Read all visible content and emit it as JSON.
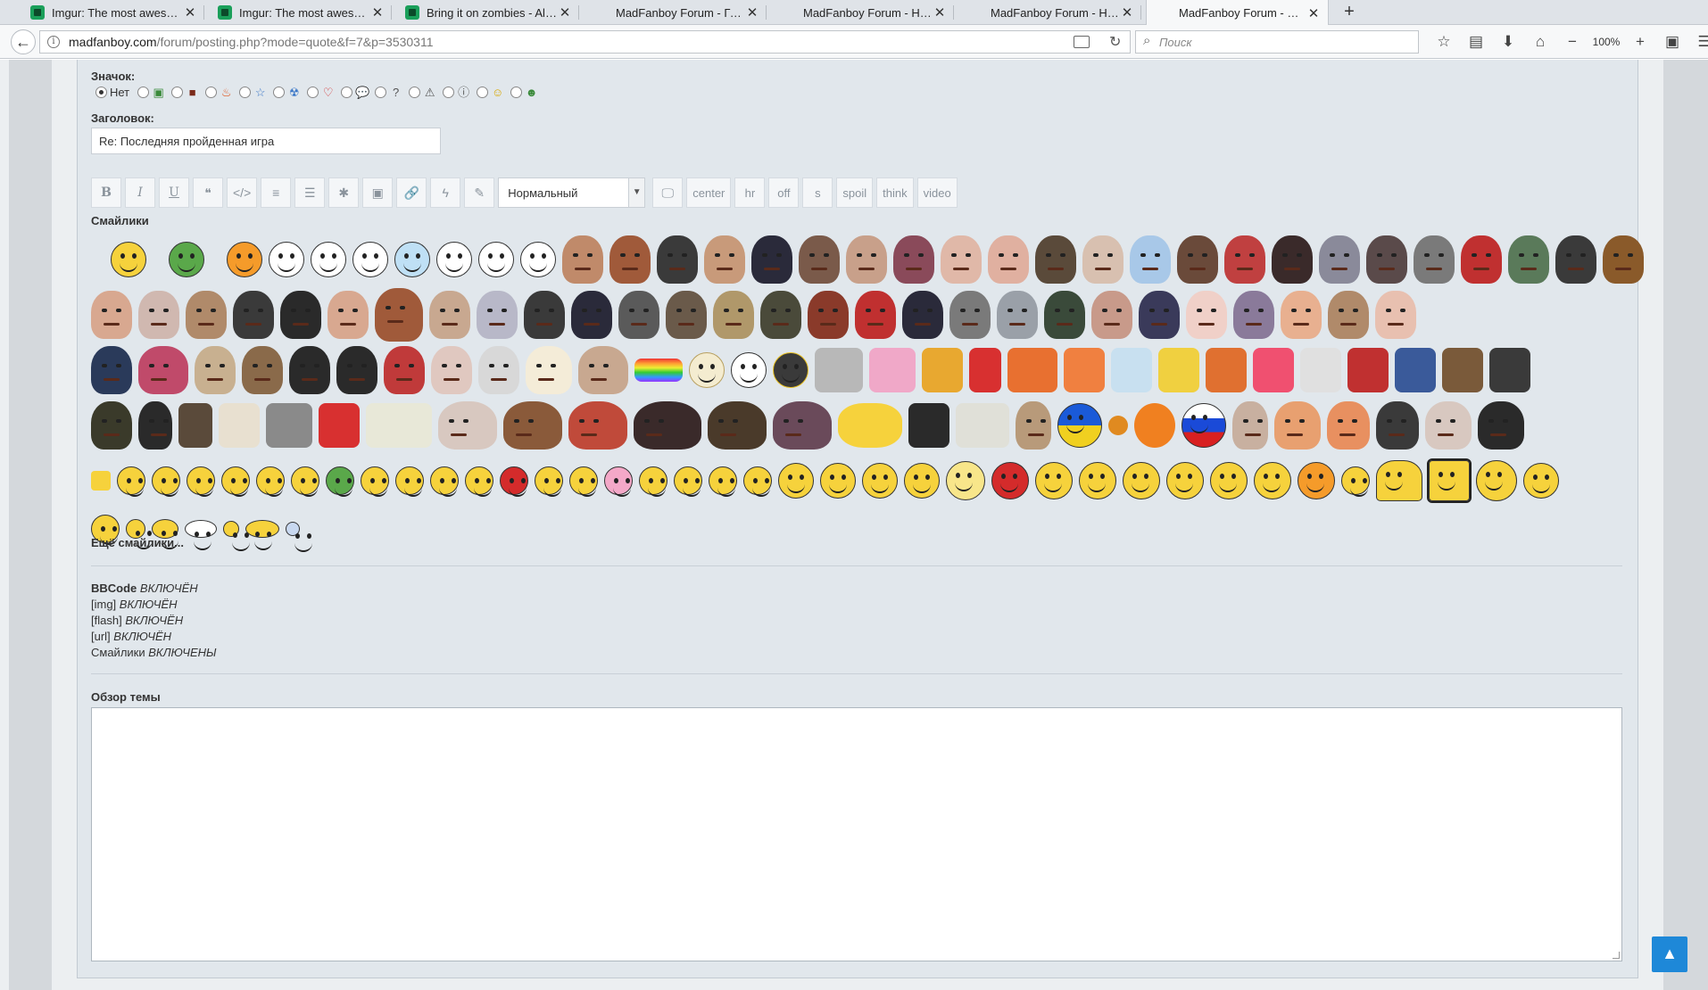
{
  "browser": {
    "tabs": [
      {
        "title": "Imgur: The most awesom...",
        "has_icon": true
      },
      {
        "title": "Imgur: The most awesom...",
        "has_icon": true
      },
      {
        "title": "Bring it on zombies - Albu...",
        "has_icon": true
      },
      {
        "title": "MadFanboy Forum - Глав...",
        "has_icon": false
      },
      {
        "title": "MadFanboy Forum - Нов...",
        "has_icon": false
      },
      {
        "title": "MadFanboy Forum - Нов...",
        "has_icon": false
      },
      {
        "title": "MadFanboy Forum - Отве...",
        "has_icon": false,
        "active": true
      }
    ],
    "new_tab": "+",
    "url_host": "madfanboy.com",
    "url_path": "/forum/posting.php?mode=quote&f=7&p=3530311",
    "search_placeholder": "Поиск",
    "zoom": "100%"
  },
  "form": {
    "icon_label": "Значок:",
    "icon_none": "Нет",
    "subject_label": "Заголовок:",
    "subject_value": "Re: Последняя пройденная игра",
    "font_size_value": "Нормальный",
    "toolbar_buttons": [
      "B",
      "I",
      "U",
      "❝",
      "</>",
      "≡",
      "☰",
      "✱",
      "▣",
      "🔗",
      "ϟ",
      "✎"
    ],
    "custom_buttons": [
      "center",
      "hr",
      "off",
      "s",
      "spoil",
      "think",
      "video"
    ],
    "smilies_label": "Смайлики",
    "more_smilies": "Ещё смайлики...",
    "bbcode_label": "BBCode",
    "bbcode_state": "ВКЛЮЧЁН",
    "img_label": "[img]",
    "img_state": "ВКЛЮЧЁН",
    "flash_label": "[flash]",
    "flash_state": "ВКЛЮЧЁН",
    "url_label": "[url]",
    "url_state": "ВКЛЮЧЁН",
    "smilies_opt_label": "Смайлики",
    "smilies_opt_state": "ВКЛЮЧЕНЫ",
    "review_label": "Обзор темы",
    "back_to_top": "▲"
  },
  "colors": {
    "panel": "#e1e7ec",
    "accent": "#1e88d8",
    "smiley_yellow": "#f6d23c"
  }
}
